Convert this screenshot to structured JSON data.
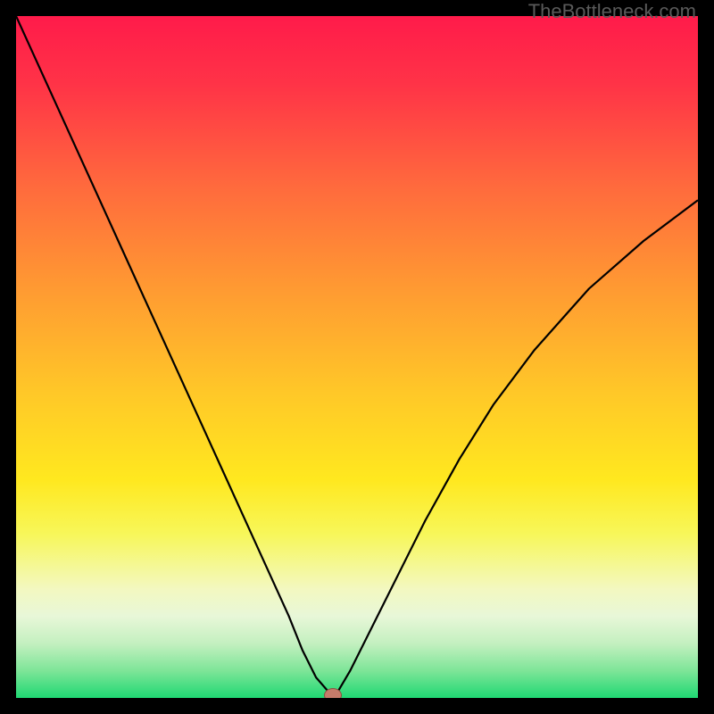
{
  "watermark": "TheBottleneck.com",
  "chart_data": {
    "type": "line",
    "title": "",
    "xlabel": "",
    "ylabel": "",
    "xlim": [
      0,
      100
    ],
    "ylim": [
      0,
      100
    ],
    "series": [
      {
        "name": "bottleneck-curve",
        "x": [
          0,
          5,
          10,
          15,
          20,
          25,
          30,
          35,
          40,
          42,
          44,
          46,
          46.5,
          47,
          49,
          52,
          56,
          60,
          65,
          70,
          76,
          84,
          92,
          100
        ],
        "values": [
          100,
          89,
          78,
          67,
          56,
          45,
          34,
          23,
          12,
          7,
          3,
          0.7,
          0,
          0.6,
          4,
          10,
          18,
          26,
          35,
          43,
          51,
          60,
          67,
          73
        ]
      }
    ],
    "marker": {
      "x": 46.5,
      "y": 0
    },
    "gradient_stops": [
      {
        "pos": 0.0,
        "color": "#ff1b4a"
      },
      {
        "pos": 0.1,
        "color": "#ff3347"
      },
      {
        "pos": 0.25,
        "color": "#ff6a3d"
      },
      {
        "pos": 0.4,
        "color": "#ff9a32"
      },
      {
        "pos": 0.55,
        "color": "#ffc728"
      },
      {
        "pos": 0.68,
        "color": "#ffe81f"
      },
      {
        "pos": 0.76,
        "color": "#f7f75a"
      },
      {
        "pos": 0.84,
        "color": "#f3f8c0"
      },
      {
        "pos": 0.88,
        "color": "#e8f7d8"
      },
      {
        "pos": 0.92,
        "color": "#c4f0c0"
      },
      {
        "pos": 0.96,
        "color": "#7ee598"
      },
      {
        "pos": 1.0,
        "color": "#1fd873"
      }
    ]
  }
}
